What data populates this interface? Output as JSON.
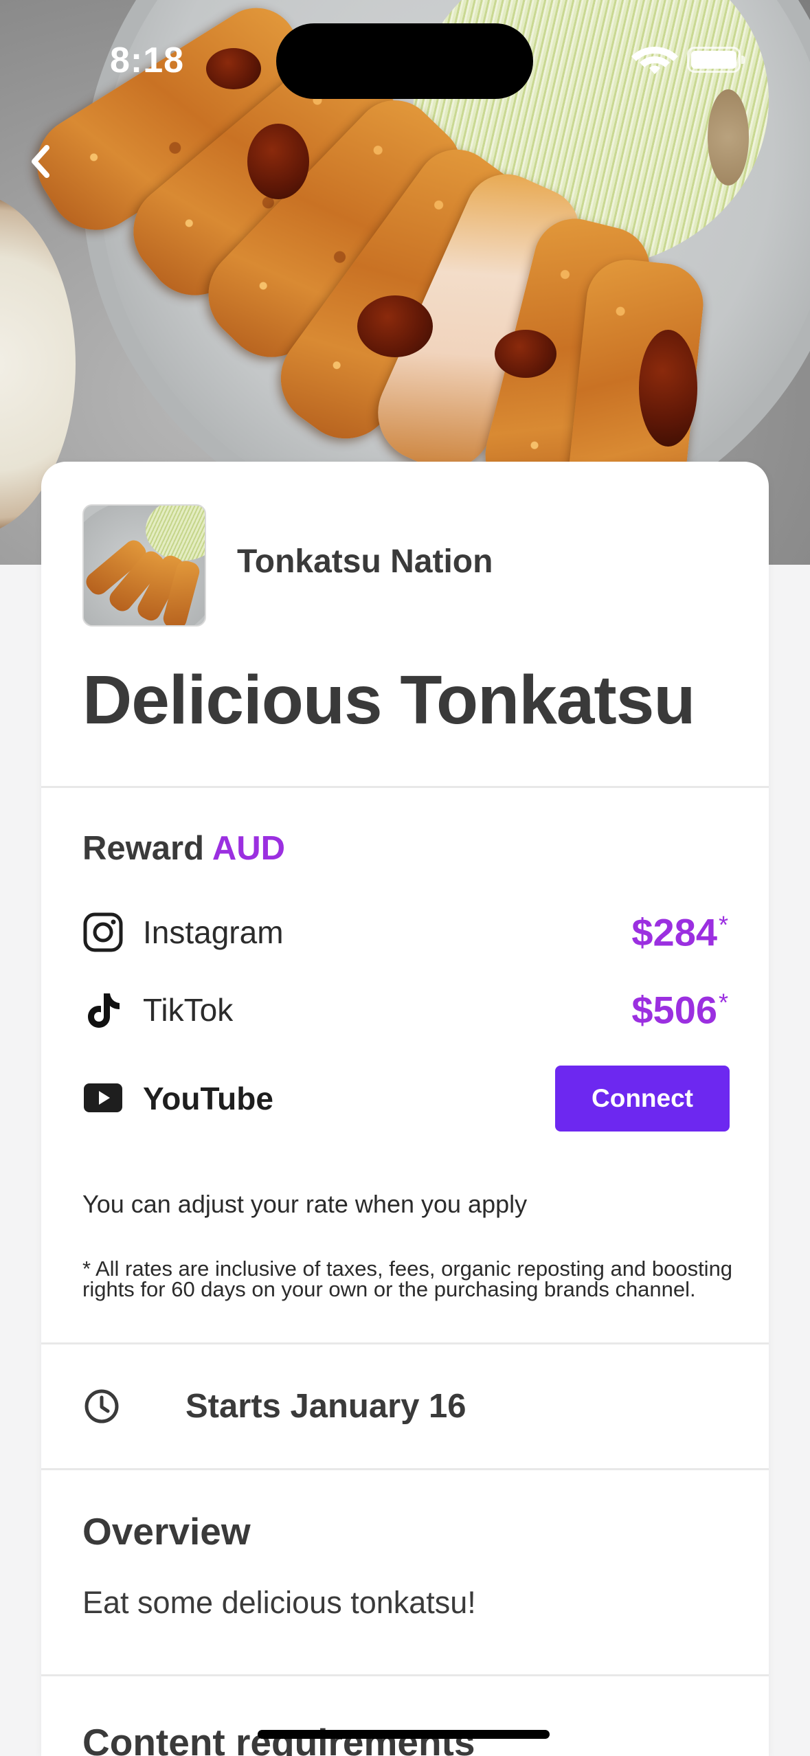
{
  "status_bar": {
    "time": "8:18"
  },
  "header": {
    "back_icon": "chevron-left-icon"
  },
  "brand": {
    "name": "Tonkatsu Nation"
  },
  "campaign": {
    "title": "Delicious Tonkatsu"
  },
  "reward": {
    "heading": "Reward",
    "currency": "AUD",
    "accent_color": "#9b2fe0",
    "platforms": [
      {
        "icon": "instagram-icon",
        "label": "Instagram",
        "rate": "$284",
        "asterisk": "*"
      },
      {
        "icon": "tiktok-icon",
        "label": "TikTok",
        "rate": "$506",
        "asterisk": "*"
      },
      {
        "icon": "youtube-icon",
        "label": "YouTube",
        "action": "Connect",
        "action_color": "#6d28f0"
      }
    ],
    "adjust_note": "You can adjust your rate when you apply",
    "disclaimer": "* All rates are inclusive of taxes, fees, organic reposting and boosting rights for 60 days on your own or the purchasing brands channel."
  },
  "schedule": {
    "icon": "clock-icon",
    "start": "Starts January 16"
  },
  "overview": {
    "heading": "Overview",
    "text": "Eat some delicious tonkatsu!"
  },
  "content_requirements": {
    "heading": "Content requirements"
  }
}
